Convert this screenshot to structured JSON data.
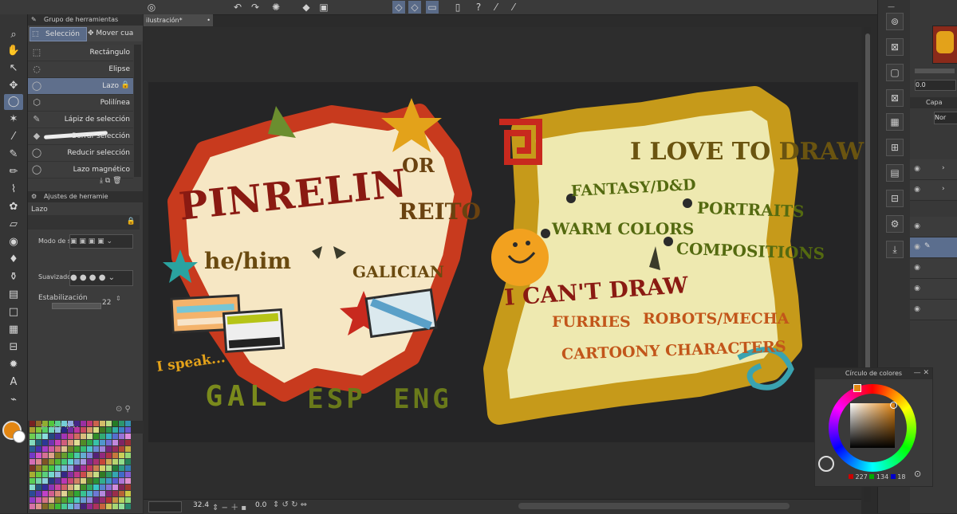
{
  "toolbar": {
    "icons": [
      "layers-icon",
      "undo-icon",
      "redo-icon",
      "loading-icon",
      "fill-icon",
      "select-icon",
      "select-lasso-icon",
      "select-shape-icon",
      "document-icon",
      "help-icon",
      "eyedropper-icon"
    ]
  },
  "document": {
    "tab_title": "ilustración*"
  },
  "subtool": {
    "panel_title": "Grupo de herramientas",
    "tabs": [
      {
        "label": "Selección"
      },
      {
        "label": "Mover cua"
      }
    ],
    "items": [
      {
        "label": "Rectángulo"
      },
      {
        "label": "Elipse"
      },
      {
        "label": "Lazo"
      },
      {
        "label": "Polilínea"
      },
      {
        "label": "Lápiz de selección"
      },
      {
        "label": "Borrar selección"
      },
      {
        "label": "Reducir selección"
      },
      {
        "label": "Lazo magnético"
      }
    ]
  },
  "tool_settings": {
    "panel_title": "Ajustes de herramie",
    "tool_name": "Lazo",
    "mode_label": "Modo de s",
    "smoothing_label": "Suavizado",
    "stabilization_label": "Estabilización",
    "stabilization_value": "22"
  },
  "canvas_footer": {
    "zoom": "32.4",
    "rotation": "0.0"
  },
  "layer_panel": {
    "tab_label": "Capa",
    "blend_mode": "Nor",
    "opacity": "0.0"
  },
  "color_wheel": {
    "title": "Círculo de colores",
    "r": "227",
    "g": "134",
    "b": "18",
    "main_color": "#e38612"
  },
  "artwork": {
    "name_main": "PINRELIN",
    "name_or": "OR",
    "name_alt": "REITO",
    "pronouns": "he/him",
    "nationality": "GALICIAN",
    "speak_label": "I speak...",
    "languages": [
      "GAL",
      "ESP",
      "ENG"
    ],
    "love_title": "I LOVE TO DRAW",
    "love_items": [
      "FANTASY/D&D",
      "PORTRAITS",
      "WARM COLORS",
      "COMPOSITIONS"
    ],
    "cant_title": "I CAN'T DRAW",
    "cant_items": [
      "FURRIES",
      "ROBOTS/MECHA",
      "CARTOONY CHARACTERS"
    ]
  }
}
